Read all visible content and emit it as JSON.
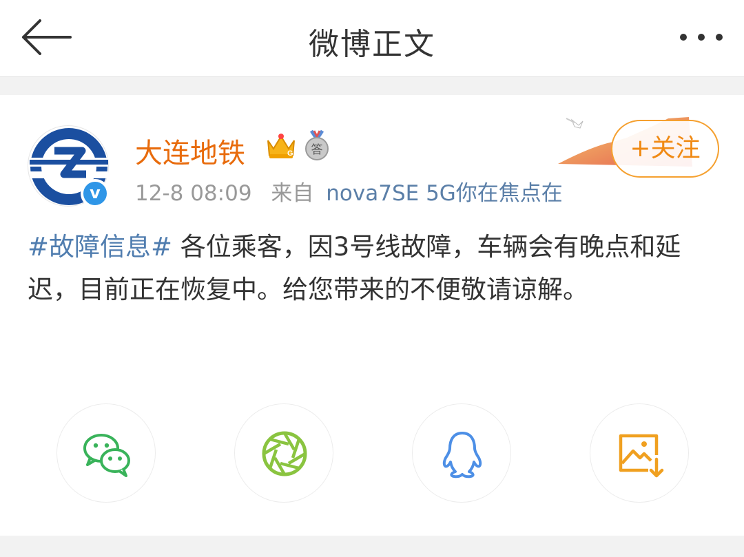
{
  "nav": {
    "title": "微博正文",
    "back_icon": "arrow-left-icon",
    "more_icon": "more-dots-icon"
  },
  "post": {
    "author": {
      "name": "大连地铁",
      "avatar_icon": "dalian-metro-logo",
      "verified_mark": "v",
      "badges": [
        "crown-member-icon",
        "answer-medal-icon"
      ],
      "badge_text": {
        "crown": "G",
        "medal": "答"
      }
    },
    "time": "12-8 08:09",
    "source_prefix": "来自",
    "source": "nova7SE 5G你在焦点在",
    "follow_label": "+关注",
    "tag": "#故障信息#",
    "body": " 各位乘客，因3号线故障，车辆会有晚点和延迟，目前正在恢复中。给您带来的不便敬请谅解。"
  },
  "share": [
    {
      "icon": "wechat-icon",
      "color": "#39b35a"
    },
    {
      "icon": "moments-icon",
      "color": "#8ac440"
    },
    {
      "icon": "qq-icon",
      "color": "#4d8fe6"
    },
    {
      "icon": "save-image-icon",
      "color": "#f0a020"
    }
  ],
  "colors": {
    "username": "#e86b0c",
    "link": "#507daf",
    "follow": "#f08a14"
  }
}
